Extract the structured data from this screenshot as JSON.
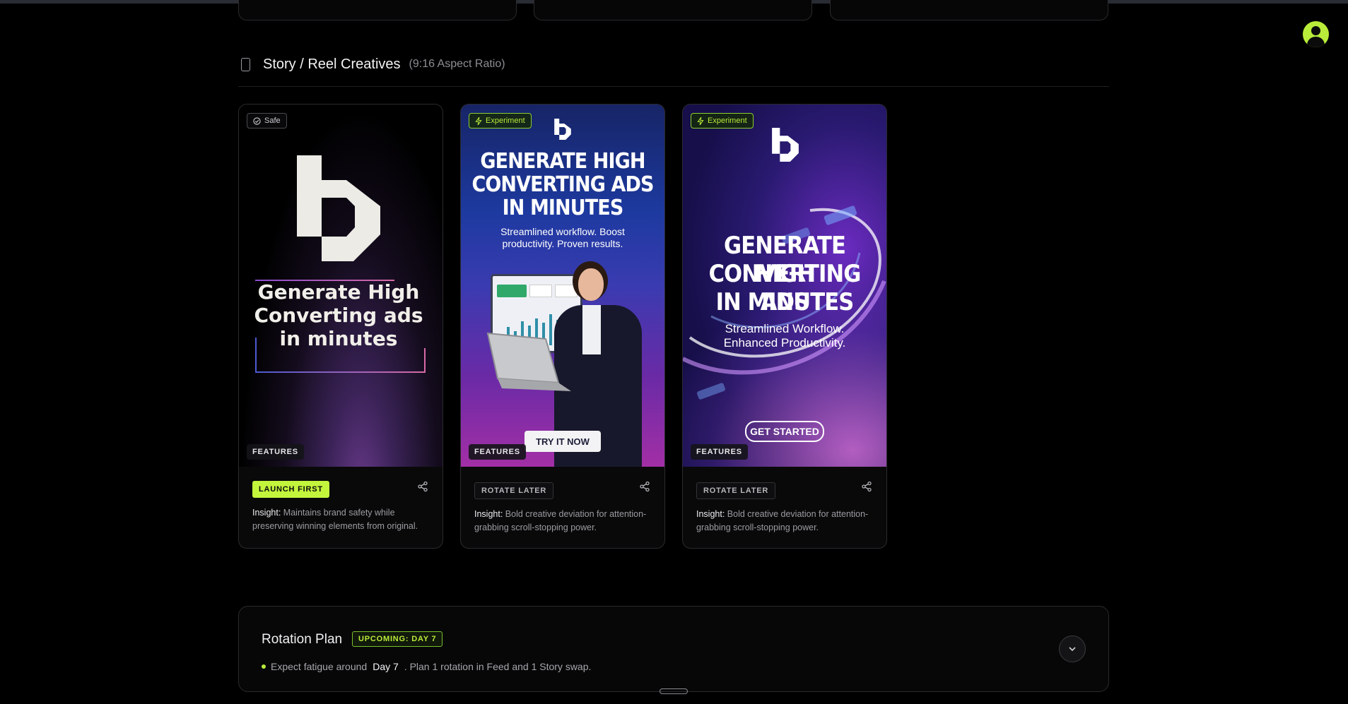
{
  "section": {
    "title": "Story / Reel Creatives",
    "subtitle": "(9:16 Aspect Ratio)"
  },
  "cards": [
    {
      "tag": "Safe",
      "feature": "FEATURES",
      "headline": "Generate High Converting ads in minutes",
      "badge": "LAUNCH FIRST",
      "insight_label": "Insight:",
      "insight": "Maintains brand safety while preserving winning elements from original."
    },
    {
      "tag": "Experiment",
      "feature": "FEATURES",
      "headline_lines": [
        "GENERATE HIGH",
        "CONVERTING ADS",
        "IN MINUTES"
      ],
      "subline": "Streamlined workflow. Boost productivity. Proven results.",
      "cta": "TRY IT NOW",
      "badge": "ROTATE LATER",
      "insight_label": "Insight:",
      "insight": "Bold creative deviation for attention-grabbing scroll-stopping power."
    },
    {
      "tag": "Experiment",
      "feature": "FEATURES",
      "headline_lines": [
        "GENERATE HIGH",
        "CONVERTING ADS",
        "IN MINUTES"
      ],
      "subline": "Streamlined Workflow. Enhanced Productivity.",
      "cta": "GET STARTED",
      "badge": "ROTATE LATER",
      "insight_label": "Insight:",
      "insight": "Bold creative deviation for attention-grabbing scroll-stopping power."
    }
  ],
  "plan": {
    "title": "Rotation Plan",
    "badge": "UPCOMING: DAY 7",
    "line_prefix": "Expect fatigue around",
    "day": "Day 7",
    "line_suffix": ". Plan 1 rotation in Feed and 1 Story swap."
  },
  "colors": {
    "accent": "#c3f53c",
    "background": "#000000"
  },
  "icons": [
    "phone-icon",
    "check-circle-icon",
    "lightning-icon",
    "share-icon",
    "chevron-down-icon",
    "avatar-icon",
    "brand-logo-icon"
  ]
}
